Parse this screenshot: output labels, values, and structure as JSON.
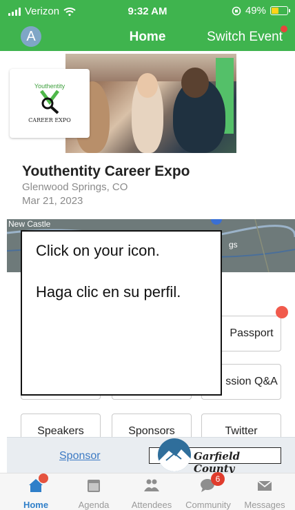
{
  "status_bar": {
    "carrier": "Verizon",
    "time": "9:32 AM",
    "battery": "49%",
    "battery_level": 0.49
  },
  "header": {
    "avatar_letter": "A",
    "title": "Home",
    "switch_event": "Switch Event"
  },
  "event": {
    "logo_top": "Youthentity",
    "logo_bottom": "CAREER EXPO",
    "title": "Youthentity Career Expo",
    "location": "Glenwood Springs, CO",
    "date": "Mar 21, 2023"
  },
  "map": {
    "town_label": "New Castle",
    "partial_label": "gs"
  },
  "menu": {
    "passport": "Passport",
    "session_qa": "ssion Q&A",
    "speakers": "Speakers",
    "sponsors": "Sponsors",
    "twitter": "Twitter"
  },
  "overlay": {
    "line1": "Click on your icon.",
    "line2": "Haga clic en su perfil."
  },
  "sponsor_bar": {
    "link": "Sponsor",
    "sponsor_name": "Garfield County"
  },
  "tabs": [
    {
      "label": "Home",
      "icon": "home-icon"
    },
    {
      "label": "Agenda",
      "icon": "calendar-icon"
    },
    {
      "label": "Attendees",
      "icon": "people-icon"
    },
    {
      "label": "Community",
      "icon": "chat-icon",
      "badge": "6"
    },
    {
      "label": "Messages",
      "icon": "mail-icon"
    }
  ],
  "colors": {
    "brand_green": "#3fb44e",
    "active_blue": "#2f7fc9",
    "alert_red": "#e8453c"
  }
}
